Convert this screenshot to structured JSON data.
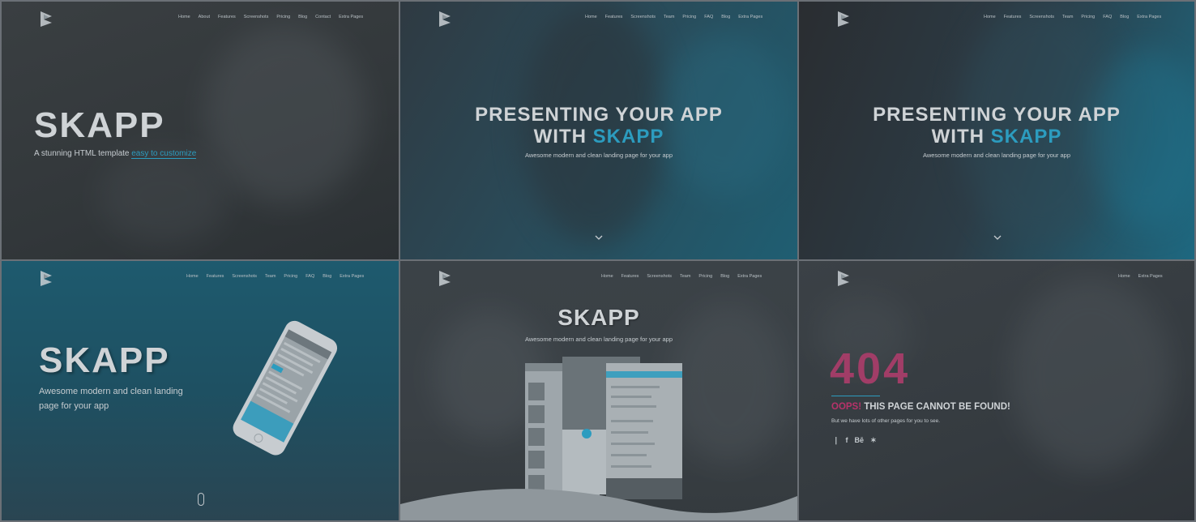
{
  "panels": {
    "p1": {
      "nav": [
        "Home",
        "About",
        "Features",
        "Screenshots",
        "Pricing",
        "Blog",
        "Contact",
        "Extra Pages"
      ],
      "title": "SKAPP",
      "subtitle_main": "A stunning HTML template ",
      "subtitle_link": "easy to customize"
    },
    "p2": {
      "nav": [
        "Home",
        "Features",
        "Screenshots",
        "Team",
        "Pricing",
        "FAQ",
        "Blog",
        "Extra Pages"
      ],
      "title_line1": "PRESENTING YOUR APP",
      "title_line2_a": "WITH ",
      "title_line2_b": "SKAPP",
      "subtitle": "Awesome modern and clean landing page for your app"
    },
    "p3": {
      "nav": [
        "Home",
        "Features",
        "Screenshots",
        "Team",
        "Pricing",
        "FAQ",
        "Blog",
        "Extra Pages"
      ],
      "title_line1": "PRESENTING YOUR APP",
      "title_line2_a": "WITH ",
      "title_line2_b": "SKAPP",
      "subtitle": "Awesome modern and clean landing page for your app"
    },
    "p4": {
      "nav": [
        "Home",
        "Features",
        "Screenshots",
        "Team",
        "Pricing",
        "FAQ",
        "Blog",
        "Extra Pages"
      ],
      "title": "SKAPP",
      "subtitle_line1": "Awesome modern and clean landing",
      "subtitle_line2": "page for your app"
    },
    "p5": {
      "nav": [
        "Home",
        "Features",
        "Screenshots",
        "Team",
        "Pricing",
        "Blog",
        "Extra Pages"
      ],
      "title": "SKAPP",
      "subtitle": "Awesome modern and clean landing page for your app"
    },
    "p6": {
      "nav": [
        "Home",
        "Extra Pages"
      ],
      "code": "404",
      "oops": "OOPS!",
      "message": " THIS PAGE CANNOT BE FOUND!",
      "sub": "But we have lots of other pages for you to see.",
      "social": [
        "twitter-icon",
        "facebook-icon",
        "behance-icon",
        "xing-icon"
      ],
      "social_glyphs": [
        "❘",
        "f",
        "Bē",
        "✶"
      ]
    }
  },
  "colors": {
    "accent": "#2c9cbf",
    "pink": "#b8326a"
  }
}
